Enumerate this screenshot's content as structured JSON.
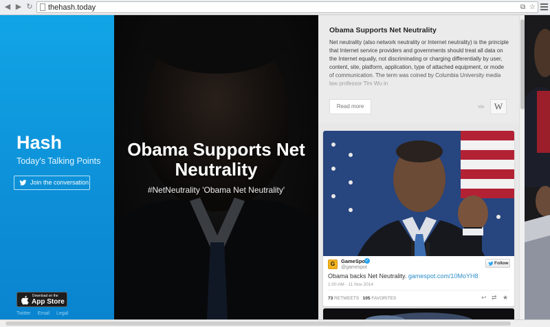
{
  "browser": {
    "url": "thehash.today",
    "back_icon": "back-arrow-icon",
    "forward_icon": "forward-arrow-icon",
    "reload_icon": "reload-icon",
    "star_icon": "star-icon"
  },
  "sidebar": {
    "brand": "Hash",
    "tagline": "Today's Talking Points",
    "join_label": "Join the conversation",
    "appstore_small": "Download on the",
    "appstore_big": "App Store",
    "footer_links": [
      "Twitter",
      "Email",
      "Legal"
    ],
    "color": "#0d96db"
  },
  "hero": {
    "title": "Obama Supports Net Neutrality",
    "tags": "#NetNeutrality 'Obama Net Neutrality'"
  },
  "wiki_card": {
    "title": "Obama Supports Net Neutrality",
    "text": "Net neutrality (also network neutrality or Internet neutrality) is the principle that Internet service providers and governments should treat all data on the Internet equally, not discriminating or charging differentially by user, content, site, platform, application, type of attached equipment, or mode of communication. The term was coined by Columbia University media law professor Tim Wu in",
    "read_more": "Read more",
    "via": "via",
    "source_logo": "W"
  },
  "tweet": {
    "avatar": "G",
    "name": "GameSpot",
    "handle": "@gamespot",
    "follow_label": "Follow",
    "text": "Obama backs Net Neutrality.",
    "link": "gamespot.com/10MoYH8",
    "date": "1:00 AM - 11 Nov 2014",
    "retweets_count": "73",
    "retweets_label": "RETWEETS",
    "favorites_count": "105",
    "favorites_label": "FAVORITES",
    "link_color": "#2a8cc9"
  }
}
